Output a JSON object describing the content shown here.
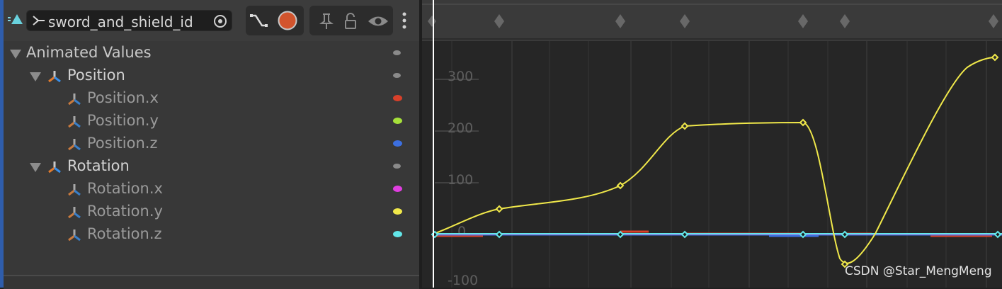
{
  "clip": {
    "name": "sword_and_shield_id"
  },
  "tree": {
    "root": "Animated Values",
    "groups": [
      {
        "label": "Position",
        "children": [
          "Position.x",
          "Position.y",
          "Position.z"
        ]
      },
      {
        "label": "Rotation",
        "children": [
          "Rotation.x",
          "Rotation.y",
          "Rotation.z"
        ]
      }
    ]
  },
  "curve_colors": {
    "Position.x": "#d8402a",
    "Position.y": "#a6e03a",
    "Position.z": "#3c6fe0",
    "Rotation.x": "#e03ee0",
    "Rotation.y": "#f0e84a",
    "Rotation.z": "#62e6e8"
  },
  "y_axis_labels": [
    "300",
    "200",
    "100",
    "0",
    "-100"
  ],
  "watermark": "CSDN @Star_MengMeng"
}
